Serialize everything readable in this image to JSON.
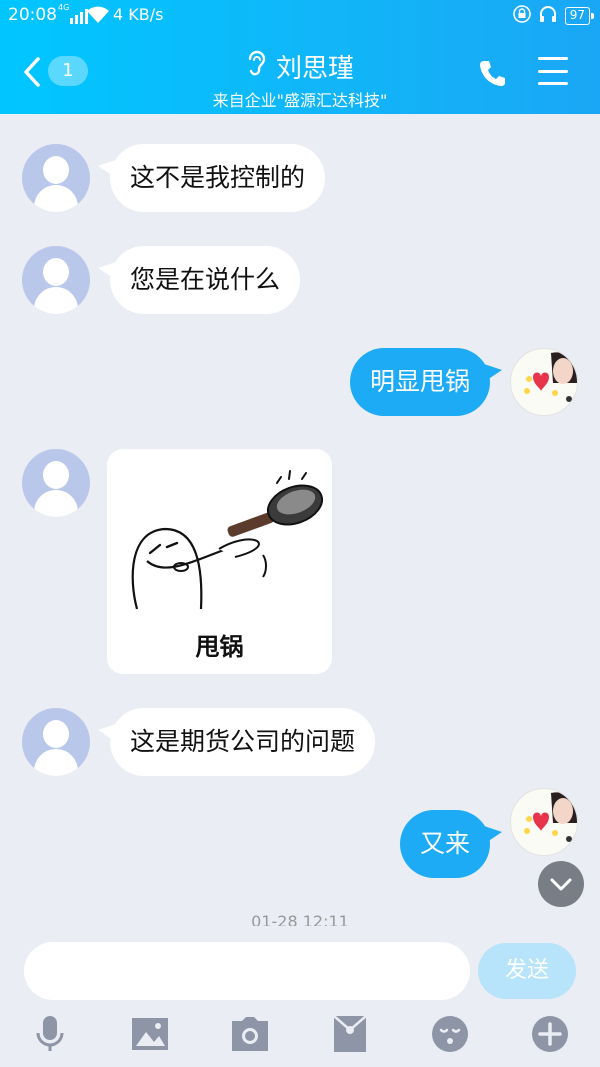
{
  "status_bar": {
    "time": "20:08",
    "network": "4G",
    "speed": "4 KB/s",
    "battery": "97"
  },
  "header": {
    "back_badge": "1",
    "contact_name": "刘思瑾",
    "subtitle": "来自企业\"盛源汇达科技\""
  },
  "messages": [
    {
      "from": "them",
      "text": "这不是我控制的"
    },
    {
      "from": "them",
      "text": "您是在说什么"
    },
    {
      "from": "me",
      "text": "明显甩锅"
    },
    {
      "from": "them",
      "sticker_caption": "甩锅"
    },
    {
      "from": "them",
      "text": "这是期货公司的问题"
    },
    {
      "from": "me",
      "text": "又来"
    }
  ],
  "timestamp": "01-28 12:11",
  "input": {
    "placeholder": "",
    "send_label": "发送"
  },
  "toolbar": [
    "mic-icon",
    "image-icon",
    "camera-icon",
    "red-packet-icon",
    "emoji-icon",
    "plus-icon"
  ],
  "colors": {
    "header": "#12b4f8",
    "outgoing_bubble": "#1eabf6",
    "background": "#ebedf4",
    "send_button": "#b7e4fb"
  }
}
